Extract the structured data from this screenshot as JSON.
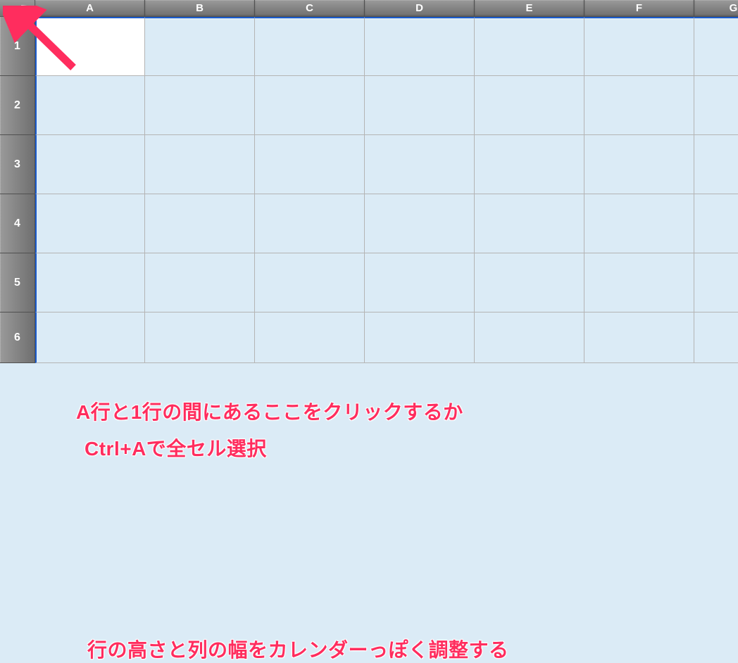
{
  "columns": [
    "A",
    "B",
    "C",
    "D",
    "E",
    "F",
    "G"
  ],
  "rows": [
    "1",
    "2",
    "3",
    "4",
    "5",
    "6"
  ],
  "annotations": {
    "line1": "A行と1行の間にあるここをクリックするか",
    "line2": "Ctrl+Aで全セル選択",
    "line3": "行の高さと列の幅をカレンダーっぽく調整する"
  }
}
